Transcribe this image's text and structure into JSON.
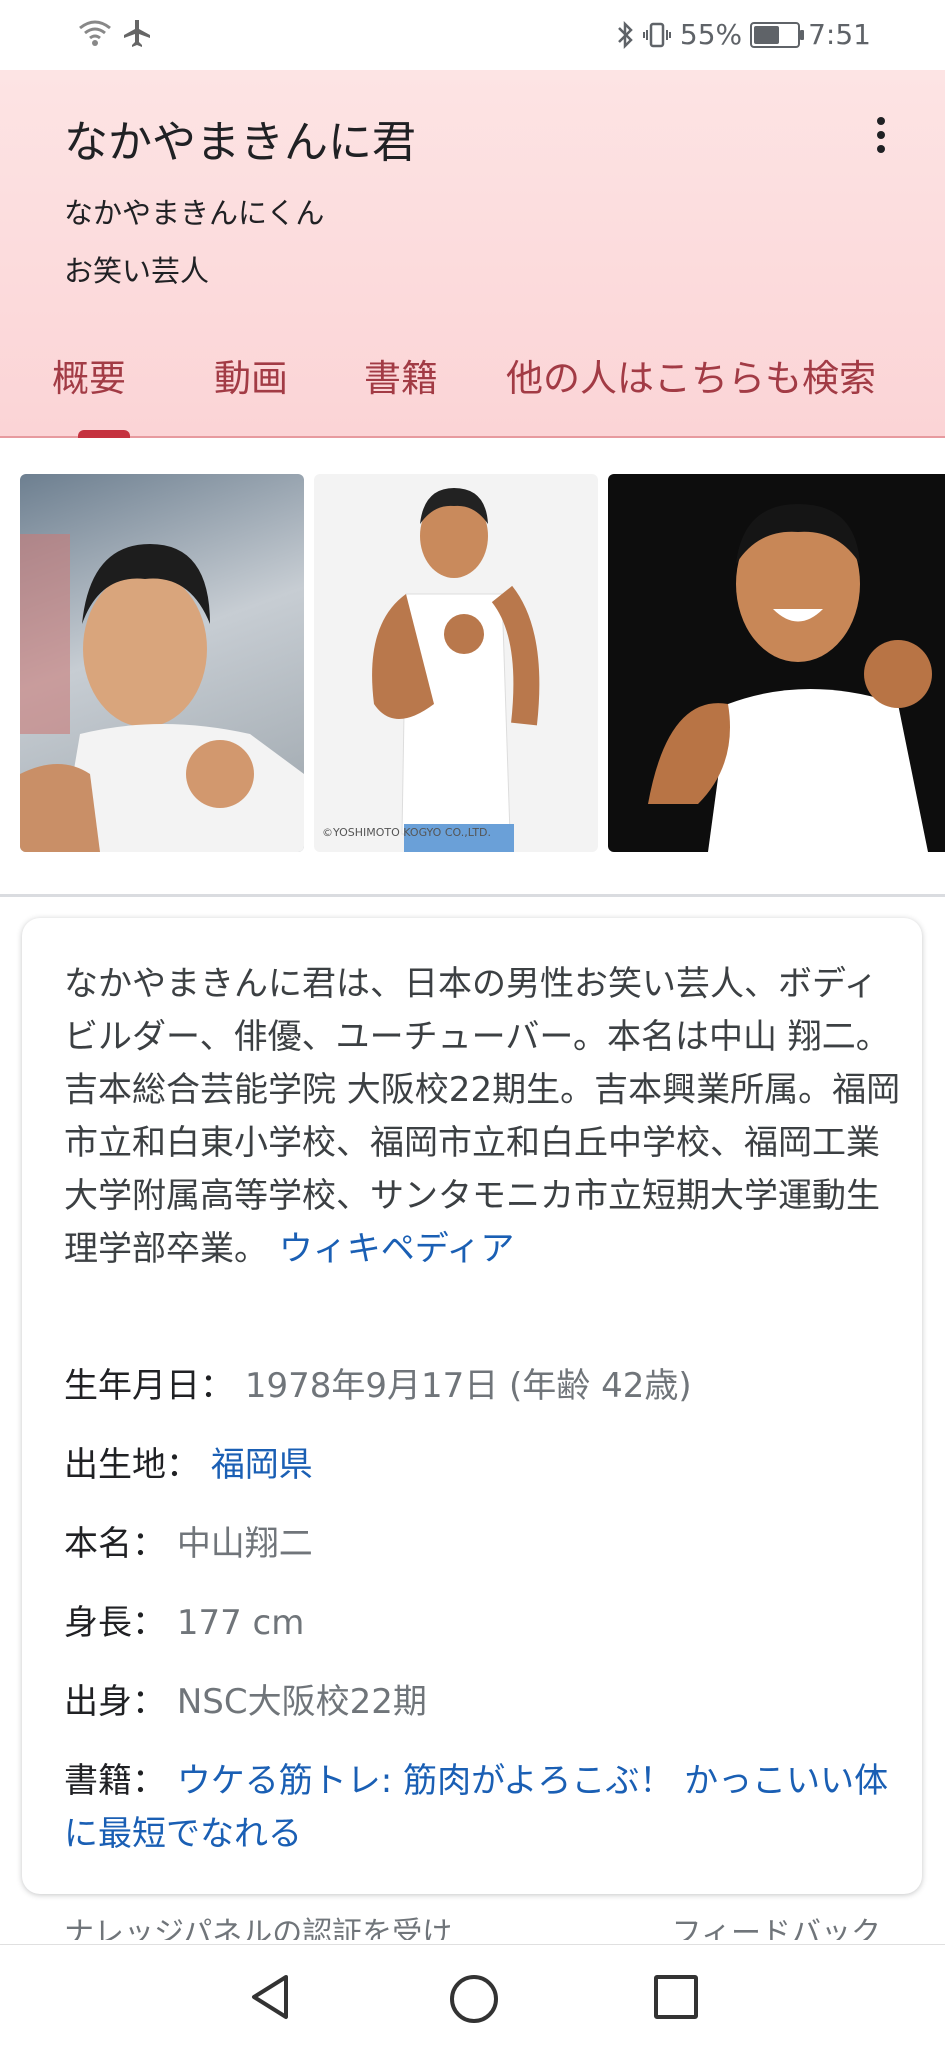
{
  "status_bar": {
    "battery_percent": "55%",
    "time": "7:51",
    "icons": [
      "wifi-icon",
      "airplane-icon",
      "bluetooth-icon",
      "vibrate-icon",
      "battery-icon"
    ]
  },
  "header": {
    "title": "なかやまきんに君",
    "reading": "なかやまきんにくん",
    "category": "お笑い芸人",
    "tabs": [
      {
        "label": "概要",
        "active": true
      },
      {
        "label": "動画",
        "active": false
      },
      {
        "label": "書籍",
        "active": false
      },
      {
        "label": "他の人はこちらも検索",
        "active": false
      }
    ]
  },
  "photos": {
    "watermark": "©YOSHIMOTO KOGYO CO.,LTD."
  },
  "card": {
    "description": "なかやまきんに君は、日本の男性お笑い芸人、ボディビルダー、俳優、ユーチューバー。本名は中山 翔二。吉本総合芸能学院 大阪校22期生。吉本興業所属。福岡市立和白東小学校、福岡市立和白丘中学校、福岡工業大学附属高等学校、サンタモニカ市立短期大学運動生理学部卒業。",
    "source_link": "ウィキペディア",
    "facts": [
      {
        "key": "生年月日",
        "value": "1978年9月17日 (年齢 42歳)",
        "link": false
      },
      {
        "key": "出生地",
        "value": "福岡県",
        "link": true
      },
      {
        "key": "本名",
        "value": "中山翔二",
        "link": false
      },
      {
        "key": "身長",
        "value": "177 cm",
        "link": false
      },
      {
        "key": "出身",
        "value": "NSC大阪校22期",
        "link": false
      },
      {
        "key": "書籍",
        "value": "ウケる筋トレ: 筋肉がよろこぶ！ かっこいい体に最短でなれる",
        "link": true
      }
    ],
    "separator": "："
  },
  "footer": {
    "claim_text": "ナレッジパネルの認証を受け",
    "feedback": "フィードバック"
  },
  "colors": {
    "header_bg": "#fbd4d6",
    "tab_text": "#a23b45",
    "tab_indicator": "#c5323f",
    "link": "#1a5fb4"
  }
}
